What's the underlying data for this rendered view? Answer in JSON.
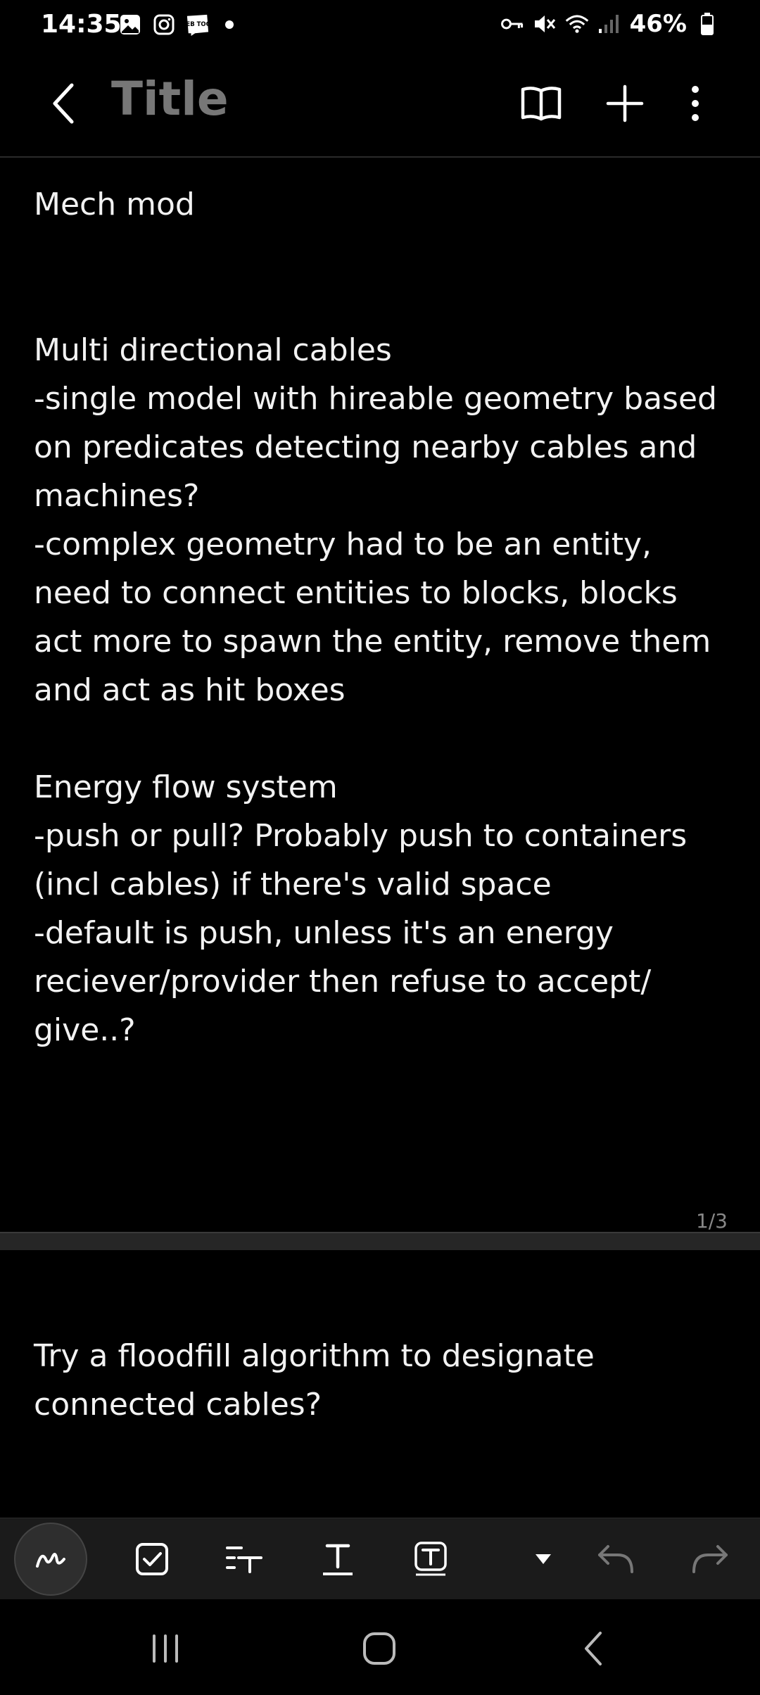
{
  "status_bar": {
    "time": "14:35",
    "left_icons": [
      "gallery-icon",
      "instagram-icon",
      "webtoon-icon",
      "notification-dot-icon"
    ],
    "webtoon_label": "WEB TOON",
    "right_icons": [
      "key-icon",
      "mute-icon",
      "wifi-icon",
      "signal-icon",
      "battery-icon"
    ],
    "battery": "46%"
  },
  "header": {
    "title": "Title",
    "back_icon": "chevron-left-icon",
    "actions": [
      "book-icon",
      "plus-icon",
      "more-vertical-icon"
    ]
  },
  "note": {
    "page1": {
      "lines": [
        "Mech mod",
        "",
        "",
        "Multi directional cables",
        "-single model with hireable geometry based",
        "on predicates detecting nearby cables and",
        "machines?",
        "-complex geometry had to be an entity,",
        "need to connect entities to blocks, blocks",
        "act more to spawn the entity, remove them",
        "and act as hit boxes",
        "",
        "Energy flow system",
        "-push or pull? Probably push to containers",
        "(incl cables) if there's valid space",
        "-default is push, unless it's an energy",
        "reciever/provider then refuse to accept/",
        "give..?"
      ],
      "page_indicator": "1/3"
    },
    "page2": {
      "lines": [
        "Try a floodfill algorithm to designate",
        "connected cables?"
      ]
    }
  },
  "toolbar": {
    "items": [
      "pen-icon",
      "checkbox-icon",
      "text-format-icon",
      "text-underline-icon",
      "text-box-icon",
      "dropdown-arrow-icon",
      "undo-icon",
      "redo-icon"
    ]
  },
  "nav_bar": {
    "items": [
      "recent-apps-icon",
      "home-icon",
      "back-icon"
    ]
  },
  "colors": {
    "background": "#000000",
    "text": "#f2f2f2",
    "title": "#777777",
    "toolbar": "#1b1b1b",
    "separator": "#262626"
  }
}
